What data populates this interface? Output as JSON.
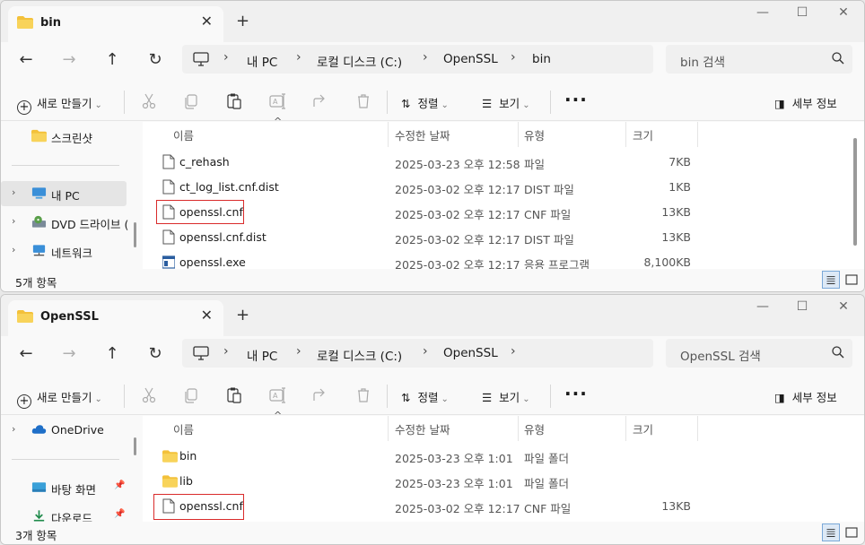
{
  "windows": [
    {
      "tab_title": "bin",
      "breadcrumb": [
        "내 PC",
        "로컬 디스크 (C:)",
        "OpenSSL",
        "bin"
      ],
      "search_placeholder": "bin 검색",
      "toolbar": {
        "new_label": "새로 만들기",
        "sort_label": "정렬",
        "view_label": "보기",
        "details_label": "세부 정보"
      },
      "nav": [
        "스크린샷",
        "내 PC",
        "DVD 드라이브 (",
        "네트워크"
      ],
      "columns": {
        "name": "이름",
        "date": "수정한 날짜",
        "type": "유형",
        "size": "크기"
      },
      "files": [
        {
          "name": "c_rehash",
          "date": "2025-03-23 오후 12:58",
          "type": "파일",
          "size": "7KB",
          "icon": "file-icon"
        },
        {
          "name": "ct_log_list.cnf.dist",
          "date": "2025-03-02 오후 12:17",
          "type": "DIST 파일",
          "size": "1KB",
          "icon": "file-icon"
        },
        {
          "name": "openssl.cnf",
          "date": "2025-03-02 오후 12:17",
          "type": "CNF 파일",
          "size": "13KB",
          "icon": "file-icon",
          "highlighted": true
        },
        {
          "name": "openssl.cnf.dist",
          "date": "2025-03-02 오후 12:17",
          "type": "DIST 파일",
          "size": "13KB",
          "icon": "file-icon"
        },
        {
          "name": "openssl.exe",
          "date": "2025-03-02 오후 12:17",
          "type": "응용 프로그램",
          "size": "8,100KB",
          "icon": "exe-icon"
        }
      ],
      "status": "5개 항목"
    },
    {
      "tab_title": "OpenSSL",
      "breadcrumb": [
        "내 PC",
        "로컬 디스크 (C:)",
        "OpenSSL"
      ],
      "search_placeholder": "OpenSSL 검색",
      "toolbar": {
        "new_label": "새로 만들기",
        "sort_label": "정렬",
        "view_label": "보기",
        "details_label": "세부 정보"
      },
      "nav": [
        "OneDrive",
        "바탕 화면",
        "다운로드"
      ],
      "columns": {
        "name": "이름",
        "date": "수정한 날짜",
        "type": "유형",
        "size": "크기"
      },
      "files": [
        {
          "name": "bin",
          "date": "2025-03-23 오후 1:01",
          "type": "파일 폴더",
          "size": "",
          "icon": "folder-icon"
        },
        {
          "name": "lib",
          "date": "2025-03-23 오후 1:01",
          "type": "파일 폴더",
          "size": "",
          "icon": "folder-icon"
        },
        {
          "name": "openssl.cnf",
          "date": "2025-03-02 오후 12:17",
          "type": "CNF 파일",
          "size": "13KB",
          "icon": "file-icon",
          "highlighted": true
        }
      ],
      "status": "3개 항목"
    }
  ],
  "colors": {
    "highlight": "#d92b2b",
    "folder": "#f3c13a",
    "selected_nav": "#e5e5e5",
    "accent": "#0067c0"
  }
}
